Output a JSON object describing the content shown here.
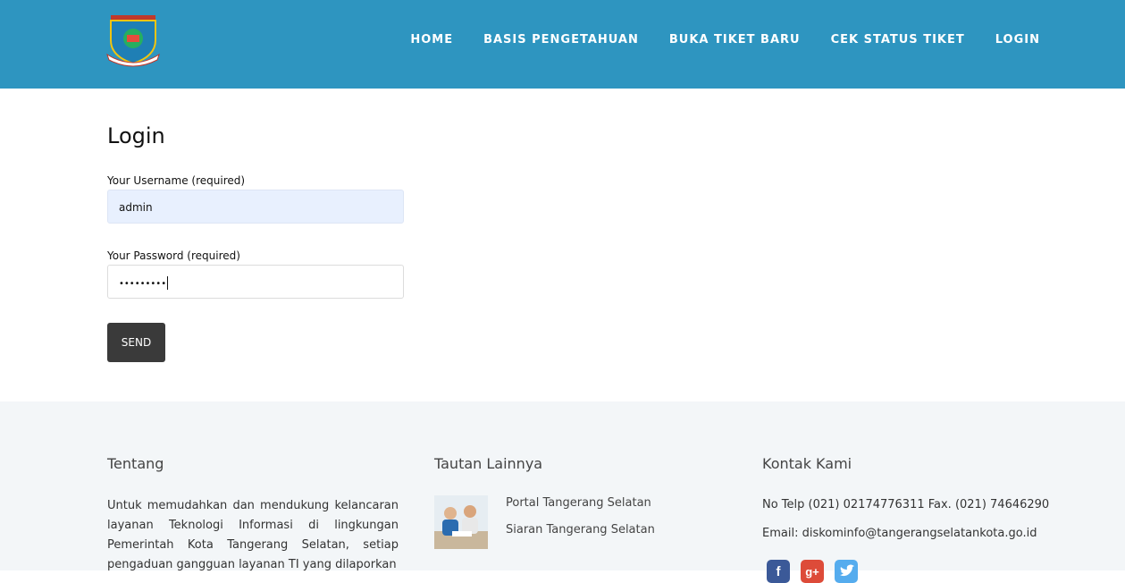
{
  "nav": {
    "items": [
      "HOME",
      "BASIS PENGETAHUAN",
      "BUKA TIKET BARU",
      "CEK STATUS TIKET",
      "LOGIN"
    ]
  },
  "login": {
    "title": "Login",
    "username_label": "Your Username (required)",
    "username_value": "admin",
    "password_label": "Your Password (required)",
    "password_masked": "•••••••••",
    "send_label": "SEND"
  },
  "footer": {
    "about": {
      "heading": "Tentang",
      "text": "Untuk memudahkan dan mendukung kelancaran layanan Teknologi Informasi di lingkungan Pemerintah Kota Tangerang Selatan, setiap pengaduan gangguan layanan TI yang dilaporkan"
    },
    "links": {
      "heading": "Tautan Lainnya",
      "items": [
        "Portal Tangerang Selatan",
        "Siaran Tangerang Selatan"
      ]
    },
    "contact": {
      "heading": "Kontak Kami",
      "phone": "No Telp (021) 02174776311 Fax. (021) 74646290",
      "email": "Email: diskominfo@tangerangselatankota.go.id"
    },
    "social": [
      {
        "icon": "facebook-icon",
        "color": "#3b5998"
      },
      {
        "icon": "google-plus-icon",
        "color": "#dd4b39"
      },
      {
        "icon": "twitter-icon",
        "color": "#55acee"
      }
    ]
  },
  "colors": {
    "header_bg": "#2e95c0",
    "button_bg": "#3a3a3a",
    "footer_bg": "#f3f6f8",
    "autofill_bg": "#e8f0fe"
  }
}
